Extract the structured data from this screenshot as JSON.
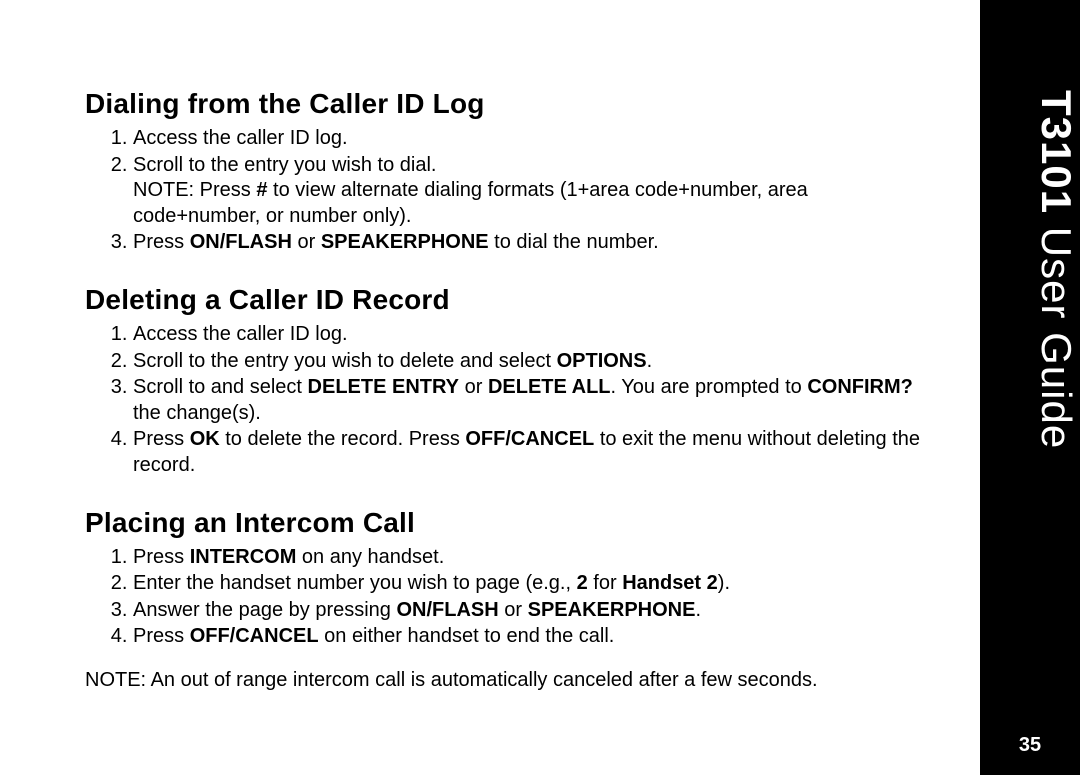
{
  "sidebar": {
    "title_bold": "T3101",
    "title_rest": " User Guide",
    "page_number": "35"
  },
  "sections": {
    "s1": {
      "heading": "Dialing from the Caller ID Log",
      "step1": "Access the caller ID log.",
      "step2": "Scroll to the entry you wish to dial.",
      "step2_note_a": "NOTE: Press ",
      "step2_note_hash": "#",
      "step2_note_b": " to view alternate dialing formats (1+area code+number, area code+number, or number only).",
      "step3_a": "Press ",
      "step3_b": "ON/FLASH",
      "step3_c": " or ",
      "step3_d": "SPEAKERPHONE",
      "step3_e": " to dial the number."
    },
    "s2": {
      "heading": "Deleting a Caller ID Record",
      "step1": "Access the caller ID log.",
      "step2_a": "Scroll to the entry you wish to delete and select ",
      "step2_b": "OPTIONS",
      "step2_c": ".",
      "step3_a": "Scroll to and select ",
      "step3_b": "DELETE ENTRY",
      "step3_c": " or ",
      "step3_d": "DELETE ALL",
      "step3_e": ". You are prompted to ",
      "step3_f": "CONFIRM?",
      "step3_g": " the change(s).",
      "step4_a": "Press ",
      "step4_b": "OK",
      "step4_c": " to delete the record. Press ",
      "step4_d": "OFF/CANCEL",
      "step4_e": " to exit the menu without deleting the record."
    },
    "s3": {
      "heading": "Placing an Intercom Call",
      "step1_a": "Press ",
      "step1_b": "INTERCOM",
      "step1_c": " on any handset.",
      "step2_a": "Enter the handset number you wish to page (e.g., ",
      "step2_b": "2",
      "step2_c": " for ",
      "step2_d": "Handset 2",
      "step2_e": ").",
      "step3_a": "Answer the page by pressing ",
      "step3_b": "ON/FLASH",
      "step3_c": " or ",
      "step3_d": "SPEAKERPHONE",
      "step3_e": ".",
      "step4_a": "Press ",
      "step4_b": "OFF/CANCEL",
      "step4_c": " on either handset to end the call.",
      "note": "NOTE: An out of range intercom call is automatically canceled after a few seconds."
    }
  }
}
